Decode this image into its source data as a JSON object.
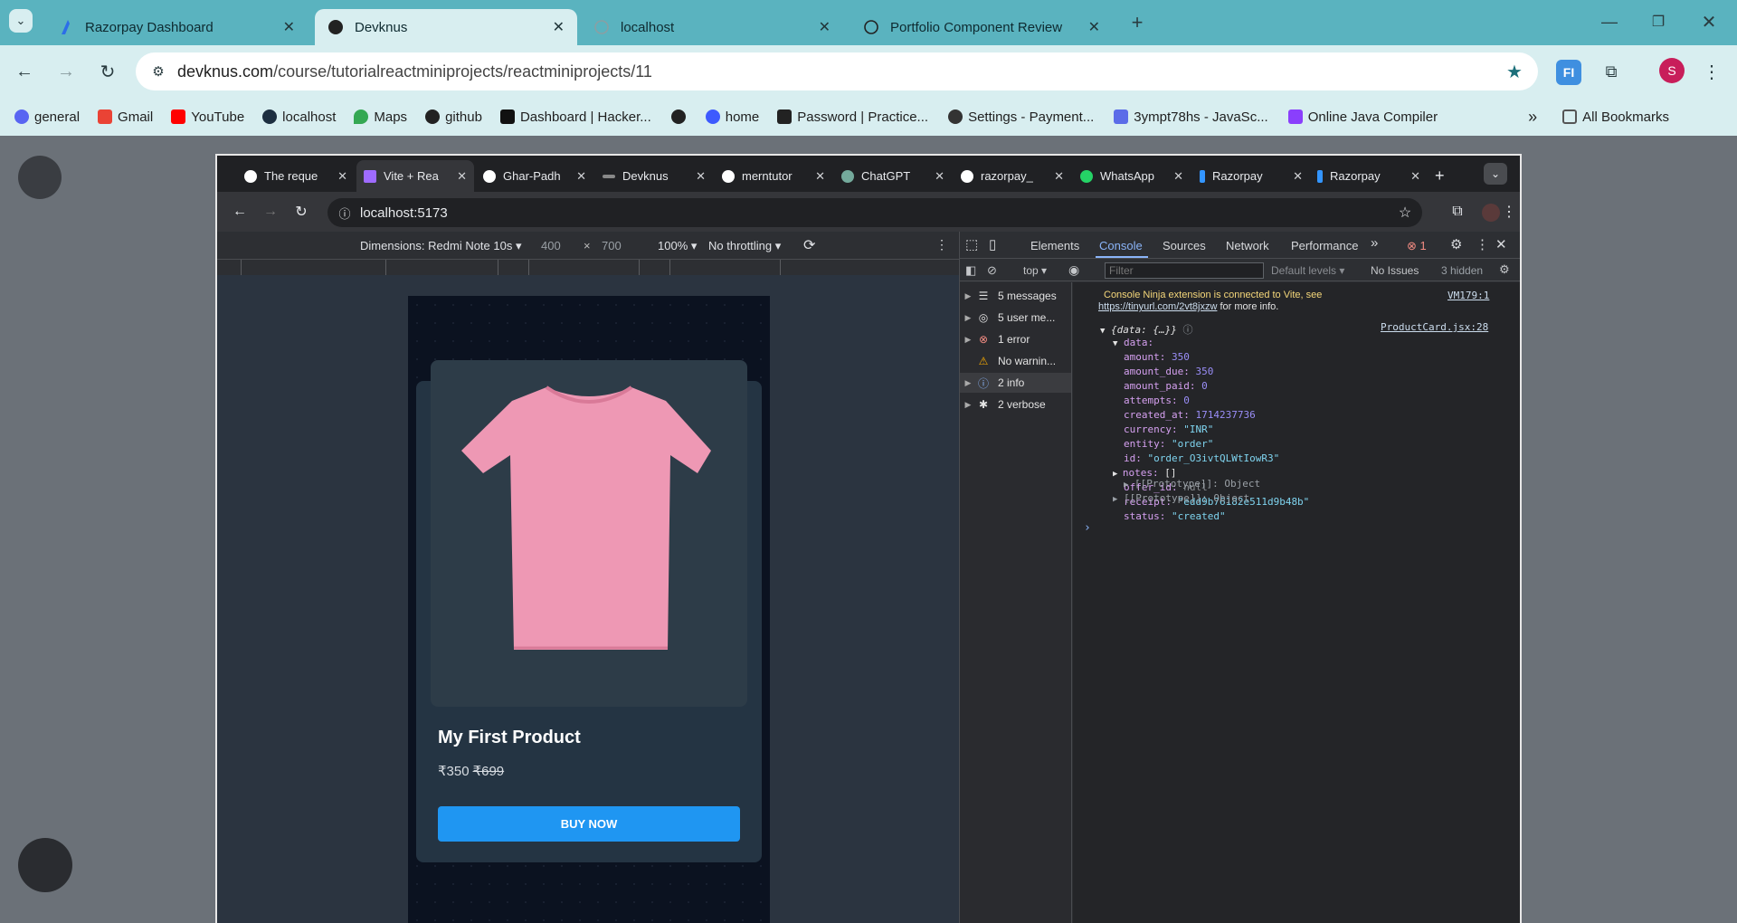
{
  "outer_tabs": [
    {
      "title": "Razorpay Dashboard"
    },
    {
      "title": "Devknus"
    },
    {
      "title": "localhost"
    },
    {
      "title": "Portfolio Component Review"
    }
  ],
  "outer_url": {
    "host": "devknus.com",
    "path": "/course/tutorialreactminiprojects/reactminiprojects/11"
  },
  "bookmarks": [
    "general",
    "Gmail",
    "YouTube",
    "localhost",
    "Maps",
    "github",
    "Dashboard | Hacker...",
    "home",
    "Password | Practice...",
    "Settings - Payment...",
    "3ympt78hs - JavaSc...",
    "Online Java Compiler"
  ],
  "all_bookmarks": "All Bookmarks",
  "profile_initial": "S",
  "inner_tabs": [
    "The reque",
    "Vite + Rea",
    "Ghar-Padh",
    "Devknus",
    "merntutor",
    "ChatGPT",
    "razorpay_",
    "WhatsApp",
    "Razorpay",
    "Razorpay"
  ],
  "inner_url": "localhost:5173",
  "device_bar": {
    "dimensions": "Dimensions: Redmi Note 10s",
    "width": "400",
    "times": "×",
    "height": "700",
    "zoom": "100%",
    "throttle": "No throttling"
  },
  "product": {
    "name": "My First Product",
    "price": "₹350",
    "old_price": "₹699",
    "button": "BUY NOW"
  },
  "devtools_tabs": [
    "Elements",
    "Console",
    "Sources",
    "Network",
    "Performance"
  ],
  "error_count": "1",
  "filter": {
    "context": "top",
    "placeholder": "Filter",
    "levels": "Default levels",
    "issues": "No Issues",
    "hidden": "3 hidden"
  },
  "sidebar": [
    "5 messages",
    "5 user me...",
    "1 error",
    "No warnin...",
    "2 info",
    "2 verbose"
  ],
  "console": {
    "ninja_1": "Console Ninja extension is connected to Vite, see",
    "ninja_link": "https://tinyurl.com/2vt8jxzw",
    "ninja_2": " for more info.",
    "ninja_src": "VM179:1",
    "obj_head": "{data: {…}}",
    "obj_src": "ProductCard.jsx:28",
    "data_key": "data:",
    "fields": [
      {
        "k": "amount:",
        "v": "350",
        "t": "num"
      },
      {
        "k": "amount_due:",
        "v": "350",
        "t": "num"
      },
      {
        "k": "amount_paid:",
        "v": "0",
        "t": "num"
      },
      {
        "k": "attempts:",
        "v": "0",
        "t": "num"
      },
      {
        "k": "created_at:",
        "v": "1714237736",
        "t": "num"
      },
      {
        "k": "currency:",
        "v": "\"INR\"",
        "t": "str"
      },
      {
        "k": "entity:",
        "v": "\"order\"",
        "t": "str"
      },
      {
        "k": "id:",
        "v": "\"order_O3ivtQLWtIowR3\"",
        "t": "str"
      },
      {
        "k": "notes:",
        "v": "[]",
        "t": "plain"
      },
      {
        "k": "offer_id:",
        "v": "null",
        "t": "nul"
      },
      {
        "k": "receipt:",
        "v": "\"edd9b76182e511d9b48b\"",
        "t": "str"
      },
      {
        "k": "status:",
        "v": "\"created\"",
        "t": "str"
      }
    ],
    "proto_inner": "[[Prototype]]: Object",
    "proto_outer": "[[Prototype]]: Object",
    "prompt": "›"
  }
}
